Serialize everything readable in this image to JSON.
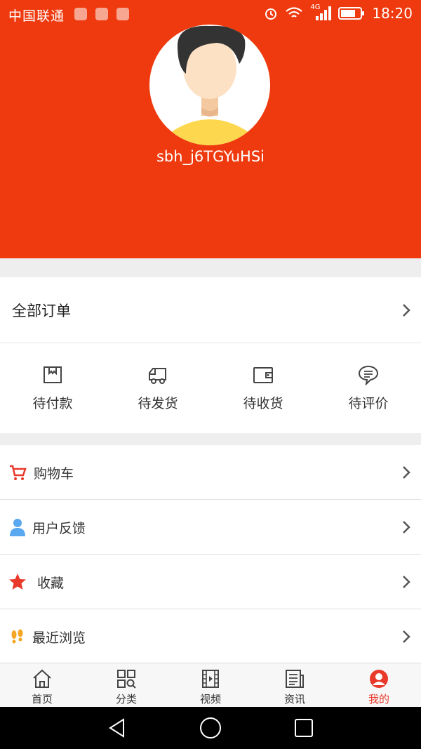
{
  "status_bar": {
    "carrier": "中国联通",
    "network": "4G",
    "time": "18:20"
  },
  "profile": {
    "username": "sbh_j6TGYuHSi"
  },
  "orders": {
    "all_orders_label": "全部订单",
    "types": [
      {
        "label": "待付款",
        "icon": "pending-payment-icon"
      },
      {
        "label": "待发货",
        "icon": "truck-icon"
      },
      {
        "label": "待收货",
        "icon": "wallet-icon"
      },
      {
        "label": "待评价",
        "icon": "comment-icon"
      }
    ]
  },
  "menu": {
    "items": [
      {
        "label": "购物车",
        "icon": "cart-icon"
      },
      {
        "label": "用户反馈",
        "icon": "user-icon"
      },
      {
        "label": "收藏",
        "icon": "star-icon"
      },
      {
        "label": "最近浏览",
        "icon": "footprints-icon"
      }
    ]
  },
  "tabbar": {
    "tabs": [
      {
        "label": "首页",
        "icon": "home-icon"
      },
      {
        "label": "分类",
        "icon": "category-icon"
      },
      {
        "label": "视频",
        "icon": "video-icon"
      },
      {
        "label": "资讯",
        "icon": "news-icon"
      },
      {
        "label": "我的",
        "icon": "profile-icon",
        "active": true
      }
    ]
  },
  "colors": {
    "brand": "#ee3a0e",
    "active_tab": "#e8392a",
    "cart_icon": "#e8392a",
    "user_icon": "#5aa8f0",
    "star_icon": "#e8392a",
    "footprints_icon": "#f5a623"
  }
}
